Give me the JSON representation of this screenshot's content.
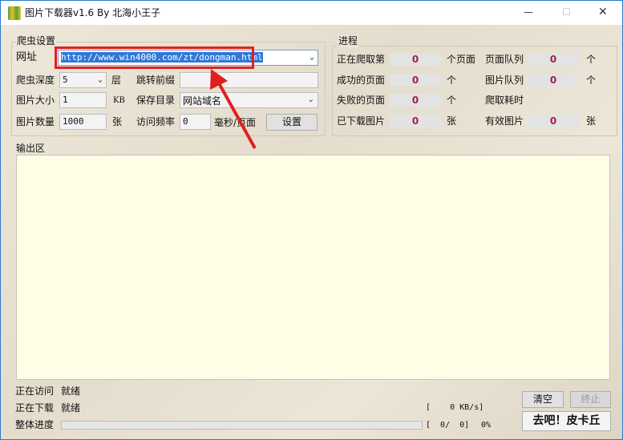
{
  "window": {
    "title": "图片下载器v1.6 By 北海小王子",
    "minimize": "—",
    "maximize": "☐",
    "close": "✕"
  },
  "settings": {
    "group_label": "爬虫设置",
    "url_label": "网址",
    "url_value": "http://www.win4000.com/zt/dongman.html",
    "depth_label": "爬虫深度",
    "depth_value": "5",
    "depth_unit": "层",
    "redirect_label": "跳转前缀",
    "redirect_value": "",
    "size_label": "图片大小",
    "size_value": "1",
    "size_unit": "KB",
    "save_label": "保存目录",
    "save_value": "网站域名",
    "count_label": "图片数量",
    "count_value": "1000",
    "count_unit": "张",
    "freq_label": "访问频率",
    "freq_value": "0",
    "freq_unit": "毫秒/页面",
    "settings_button": "设置"
  },
  "progress": {
    "group_label": "进程",
    "rows": [
      {
        "label": "正在爬取第",
        "value": "0",
        "unit": "个页面",
        "label2": "页面队列",
        "value2": "0",
        "unit2": "个"
      },
      {
        "label": "成功的页面",
        "value": "0",
        "unit": "个",
        "label2": "图片队列",
        "value2": "0",
        "unit2": "个"
      },
      {
        "label": "失败的页面",
        "value": "0",
        "unit": "个",
        "label2": "爬取耗时",
        "value2": null,
        "unit2": ""
      },
      {
        "label": "已下载图片",
        "value": "0",
        "unit": "张",
        "label2": "有效图片",
        "value2": "0",
        "unit2": "张"
      }
    ]
  },
  "output": {
    "label": "输出区",
    "text": ""
  },
  "status": {
    "visiting_label": "正在访问",
    "visiting_value": "就绪",
    "downloading_label": "正在下载",
    "downloading_value": "就绪",
    "overall_label": "整体进度",
    "overall_percent": 0,
    "speed": "[    0 KB/s]",
    "counts": "[  0/  0]",
    "percent_text": "0%"
  },
  "buttons": {
    "clear": "清空",
    "stop": "终止",
    "go": "去吧！皮卡丘"
  },
  "colors": {
    "highlight": "#e02020",
    "value": "#a0224a",
    "output_bg": "#fefde6"
  }
}
